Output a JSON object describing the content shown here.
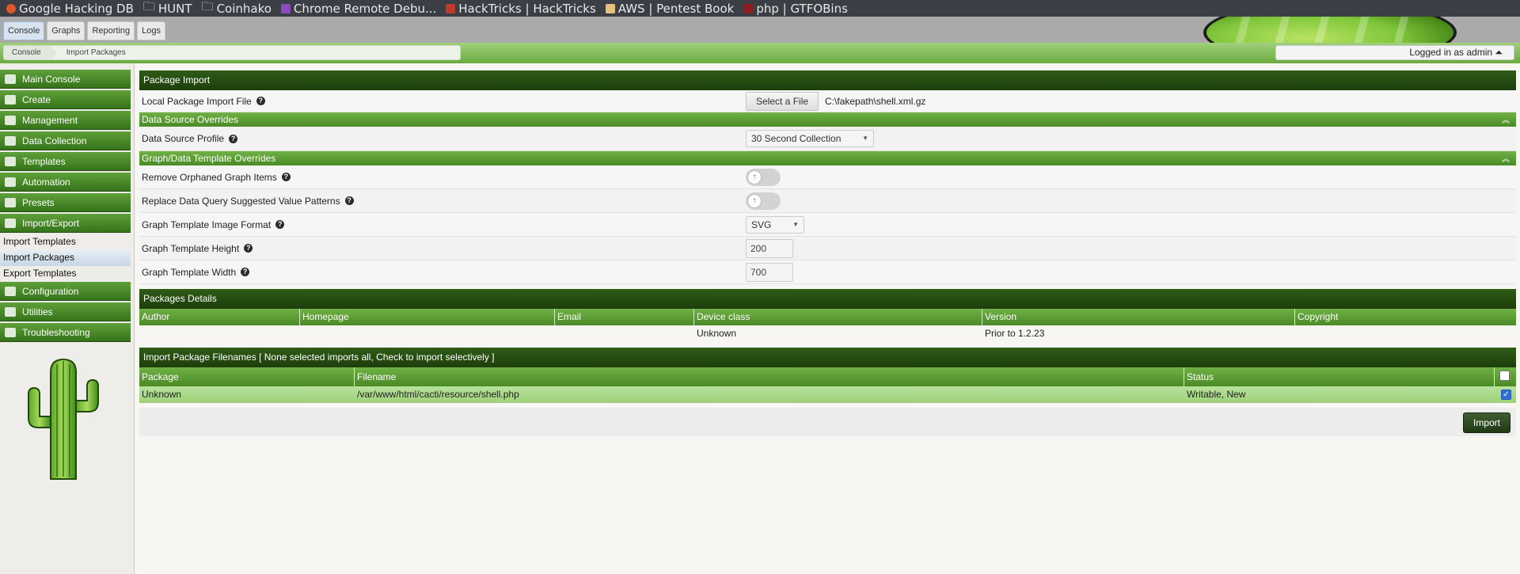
{
  "bookmarks": [
    {
      "label": "Google Hacking DB",
      "icon": "ghdb-icon",
      "color": "#e0572b"
    },
    {
      "label": "HUNT",
      "icon": "folder-icon",
      "color": ""
    },
    {
      "label": "Coinhako",
      "icon": "folder-icon",
      "color": ""
    },
    {
      "label": "Chrome Remote Debu...",
      "icon": "chrome-remote-icon",
      "color": "#8a4bbf"
    },
    {
      "label": "HackTricks | HackTricks",
      "icon": "hacktricks-icon",
      "color": "#c0392b"
    },
    {
      "label": "AWS | Pentest Book",
      "icon": "pentestbook-icon",
      "color": "#e8c07a"
    },
    {
      "label": "php | GTFOBins",
      "icon": "gtfobins-icon",
      "color": "#8b1e1e"
    }
  ],
  "tabs": [
    "Console",
    "Graphs",
    "Reporting",
    "Logs"
  ],
  "breadcrumb": [
    "Console",
    "Import Packages"
  ],
  "user": "Logged in as admin ⏶",
  "sidebar": {
    "items": [
      {
        "label": "Main Console",
        "icon": "map-icon"
      },
      {
        "label": "Create",
        "icon": "chart-icon"
      },
      {
        "label": "Management",
        "icon": "home-icon"
      },
      {
        "label": "Data Collection",
        "icon": "database-icon"
      },
      {
        "label": "Templates",
        "icon": "copy-icon"
      },
      {
        "label": "Automation",
        "icon": "refresh-icon"
      },
      {
        "label": "Presets",
        "icon": "archive-icon"
      },
      {
        "label": "Import/Export",
        "icon": "exchange-icon"
      }
    ],
    "subitems": [
      "Import Templates",
      "Import Packages",
      "Export Templates"
    ],
    "items_after": [
      {
        "label": "Configuration",
        "icon": "sliders-icon"
      },
      {
        "label": "Utilities",
        "icon": "gears-icon"
      },
      {
        "label": "Troubleshooting",
        "icon": "bug-icon"
      }
    ]
  },
  "package_import": {
    "title": "Package Import",
    "file_label": "Local Package Import File",
    "select_button": "Select a File",
    "file_path": "C:\\fakepath\\shell.xml.gz",
    "ds_overrides": "Data Source Overrides",
    "ds_profile_label": "Data Source Profile",
    "ds_profile_value": "30 Second Collection",
    "graph_overrides": "Graph/Data Template Overrides",
    "remove_orphaned_label": "Remove Orphaned Graph Items",
    "replace_patterns_label": "Replace Data Query Suggested Value Patterns",
    "image_format_label": "Graph Template Image Format",
    "image_format_value": "SVG",
    "height_label": "Graph Template Height",
    "height_value": "200",
    "width_label": "Graph Template Width",
    "width_value": "700"
  },
  "package_details": {
    "title": "Packages Details",
    "columns": [
      "Author",
      "Homepage",
      "Email",
      "Device class",
      "Version",
      "Copyright"
    ],
    "row": [
      "",
      "",
      "",
      "Unknown",
      "Prior to 1.2.23",
      ""
    ]
  },
  "filenames": {
    "title": "Import Package Filenames [ None selected imports all, Check to import selectively ]",
    "columns": [
      "Package",
      "Filename",
      "Status"
    ],
    "row": [
      "Unknown",
      "/var/www/html/cacti/resource/shell.php",
      "Writable, New"
    ]
  },
  "import_button": "Import"
}
